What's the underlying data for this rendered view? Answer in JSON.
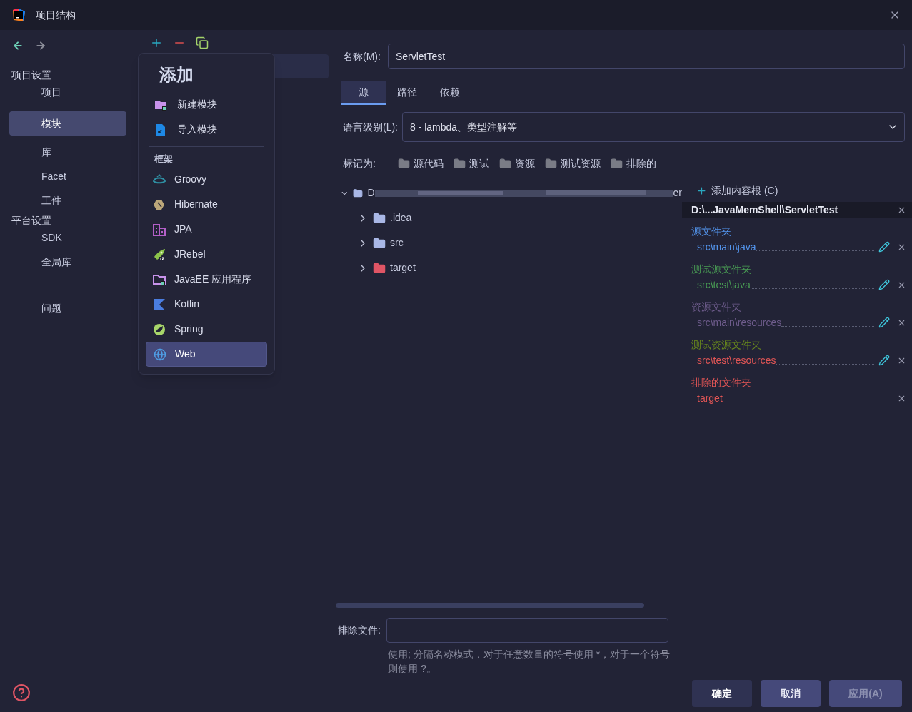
{
  "window": {
    "title": "项目结构"
  },
  "sidebar": {
    "sections": [
      {
        "title": "项目设置",
        "items": [
          {
            "label": "项目",
            "selected": false
          },
          {
            "label": "模块",
            "selected": true
          },
          {
            "label": "库",
            "selected": false
          },
          {
            "label": "Facet",
            "selected": false
          },
          {
            "label": "工件",
            "selected": false
          }
        ]
      },
      {
        "title": "平台设置",
        "items": [
          {
            "label": "SDK",
            "selected": false
          },
          {
            "label": "全局库",
            "selected": false
          }
        ]
      }
    ],
    "bottom_items": [
      {
        "label": "问题",
        "selected": false
      }
    ]
  },
  "add_menu": {
    "title": "添加",
    "items": [
      {
        "label": "新建模块",
        "kind": "new-module"
      },
      {
        "label": "导入模块",
        "kind": "import-module"
      }
    ],
    "section": "框架",
    "frameworks": [
      {
        "label": "Groovy",
        "kind": "groovy",
        "selected": false
      },
      {
        "label": "Hibernate",
        "kind": "hibernate",
        "selected": false
      },
      {
        "label": "JPA",
        "kind": "jpa",
        "selected": false
      },
      {
        "label": "JRebel",
        "kind": "jrebel",
        "selected": false
      },
      {
        "label": "JavaEE 应用程序",
        "kind": "javaee",
        "selected": false
      },
      {
        "label": "Kotlin",
        "kind": "kotlin",
        "selected": false
      },
      {
        "label": "Spring",
        "kind": "spring",
        "selected": false
      },
      {
        "label": "Web",
        "kind": "web",
        "selected": true
      }
    ]
  },
  "module": {
    "name_label": "名称(M):",
    "name": "ServletTest",
    "tabs": [
      {
        "label": "源",
        "selected": true
      },
      {
        "label": "路径",
        "selected": false
      },
      {
        "label": "依赖",
        "selected": false
      }
    ],
    "language_label": "语言级别(L):",
    "language_level": "8 - lambda、类型注解等",
    "mark_as_label": "标记为:",
    "mark_as": [
      {
        "label": "源代码"
      },
      {
        "label": "测试"
      },
      {
        "label": "资源"
      },
      {
        "label": "测试资源"
      },
      {
        "label": "排除的"
      }
    ],
    "tree": {
      "label_start": "D",
      "label_end": "er",
      "kind": "folder",
      "expanded": true,
      "children": [
        {
          "label": ".idea",
          "kind": "folder",
          "expanded": false
        },
        {
          "label": "src",
          "kind": "folder",
          "expanded": false
        },
        {
          "label": "target",
          "kind": "excluded",
          "expanded": false
        }
      ]
    },
    "content_root": {
      "add_label": "添加内容根 (C)",
      "path": "D:\\...JavaMemShell\\ServletTest",
      "groups": [
        {
          "title": "源文件夹",
          "color": "#5394ec",
          "folders": [
            {
              "path": "src\\main\\java",
              "color": "#5394ec",
              "editable": true
            }
          ]
        },
        {
          "title": "测试源文件夹",
          "color": "#499c54",
          "folders": [
            {
              "path": "src\\test\\java",
              "color": "#499c54",
              "editable": true
            }
          ]
        },
        {
          "title": "资源文件夹",
          "color": "#6e5c8c",
          "folders": [
            {
              "path": "src\\main\\resources",
              "color": "#6e5c8c",
              "editable": true
            }
          ]
        },
        {
          "title": "测试资源文件夹",
          "color": "#6a8a1c",
          "folders": [
            {
              "path": "src\\test\\resources",
              "color": "#e05555",
              "editable": true
            }
          ]
        },
        {
          "title": "排除的文件夹",
          "color": "#e05555",
          "folders": [
            {
              "path": "target",
              "color": "#e05555",
              "editable": false
            }
          ]
        }
      ]
    },
    "exclude_label": "排除文件:",
    "exclude_hint": "使用; 分隔名称模式，对于任意数量的符号使用 *，对于一个符号则使用 **?**。"
  },
  "buttons": [
    {
      "label": "确定",
      "kind": "default",
      "disabled": false
    },
    {
      "label": "取消",
      "kind": "normal",
      "disabled": false
    },
    {
      "label": "应用(A)",
      "kind": "normal",
      "disabled": true
    }
  ]
}
